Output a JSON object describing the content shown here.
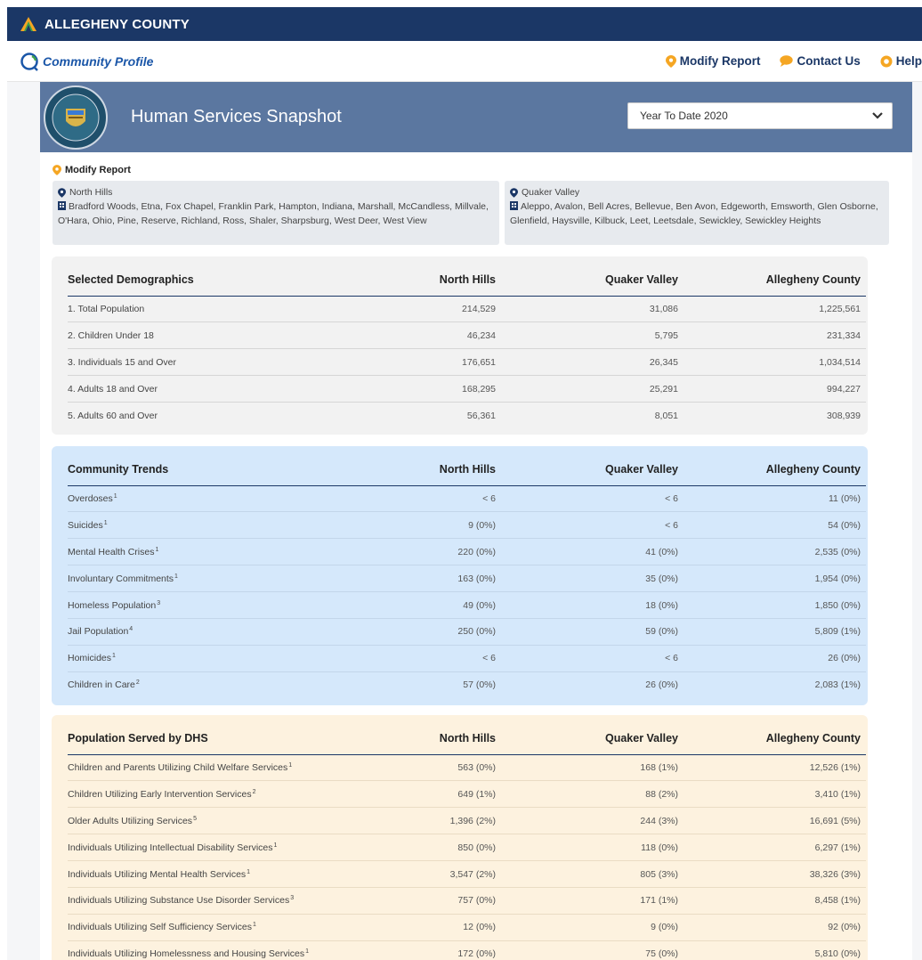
{
  "topbar": {
    "brand": "ALLEGHENY COUNTY"
  },
  "nav": {
    "brand": "Community Profile",
    "links": [
      "Modify Report",
      "Contact Us",
      "Help"
    ]
  },
  "header": {
    "title": "Human Services Snapshot",
    "period": "Year To Date 2020"
  },
  "modify_label": "Modify Report",
  "regions": [
    {
      "name": "North Hills",
      "municipalities": "Bradford Woods, Etna, Fox Chapel, Franklin Park, Hampton, Indiana, Marshall, McCandless, Millvale, O'Hara, Ohio, Pine, Reserve, Richland, Ross, Shaler, Sharpsburg, West Deer, West View"
    },
    {
      "name": "Quaker Valley",
      "municipalities": "Aleppo, Avalon, Bell Acres, Bellevue, Ben Avon, Edgeworth, Emsworth, Glen Osborne, Glenfield, Haysville, Kilbuck, Leet, Leetsdale, Sewickley, Sewickley Heights"
    }
  ],
  "colors": {
    "topbar": "#1b3766",
    "header": "#5b77a0",
    "accent_orange": "#f5a623",
    "blue_card": "#d5e8fb",
    "orange_card": "#fdf2df",
    "gray_card": "#f2f2f2"
  },
  "tables": {
    "demographics": {
      "headers": [
        "Selected Demographics",
        "North Hills",
        "Quaker Valley",
        "Allegheny County"
      ],
      "rows": [
        {
          "label": "1. Total Population",
          "sup": "",
          "values": [
            "214,529",
            "31,086",
            "1,225,561"
          ]
        },
        {
          "label": "2. Children Under 18",
          "sup": "",
          "values": [
            "46,234",
            "5,795",
            "231,334"
          ]
        },
        {
          "label": "3. Individuals 15 and Over",
          "sup": "",
          "values": [
            "176,651",
            "26,345",
            "1,034,514"
          ]
        },
        {
          "label": "4. Adults 18 and Over",
          "sup": "",
          "values": [
            "168,295",
            "25,291",
            "994,227"
          ]
        },
        {
          "label": "5. Adults 60 and Over",
          "sup": "",
          "values": [
            "56,361",
            "8,051",
            "308,939"
          ]
        }
      ]
    },
    "trends": {
      "headers": [
        "Community Trends",
        "North Hills",
        "Quaker Valley",
        "Allegheny County"
      ],
      "rows": [
        {
          "label": "Overdoses",
          "sup": "1",
          "values": [
            "< 6",
            "< 6",
            "11 (0%)"
          ]
        },
        {
          "label": "Suicides",
          "sup": "1",
          "values": [
            "9 (0%)",
            "< 6",
            "54 (0%)"
          ]
        },
        {
          "label": "Mental Health Crises",
          "sup": "1",
          "values": [
            "220 (0%)",
            "41 (0%)",
            "2,535 (0%)"
          ]
        },
        {
          "label": "Involuntary Commitments",
          "sup": "1",
          "values": [
            "163 (0%)",
            "35 (0%)",
            "1,954 (0%)"
          ]
        },
        {
          "label": "Homeless Population",
          "sup": "3",
          "values": [
            "49 (0%)",
            "18 (0%)",
            "1,850 (0%)"
          ]
        },
        {
          "label": "Jail Population",
          "sup": "4",
          "values": [
            "250 (0%)",
            "59 (0%)",
            "5,809 (1%)"
          ]
        },
        {
          "label": "Homicides",
          "sup": "1",
          "values": [
            "< 6",
            "< 6",
            "26 (0%)"
          ]
        },
        {
          "label": "Children in Care",
          "sup": "2",
          "values": [
            "57 (0%)",
            "26 (0%)",
            "2,083 (1%)"
          ]
        }
      ]
    },
    "dhs": {
      "headers": [
        "Population Served by DHS",
        "North Hills",
        "Quaker Valley",
        "Allegheny County"
      ],
      "rows": [
        {
          "label": "Children and Parents Utilizing Child Welfare Services",
          "sup": "1",
          "values": [
            "563 (0%)",
            "168 (1%)",
            "12,526 (1%)"
          ]
        },
        {
          "label": "Children Utilizing Early Intervention Services",
          "sup": "2",
          "values": [
            "649 (1%)",
            "88 (2%)",
            "3,410 (1%)"
          ]
        },
        {
          "label": "Older Adults Utilizing Services",
          "sup": "5",
          "values": [
            "1,396 (2%)",
            "244 (3%)",
            "16,691 (5%)"
          ]
        },
        {
          "label": "Individuals Utilizing Intellectual Disability Services",
          "sup": "1",
          "values": [
            "850 (0%)",
            "118 (0%)",
            "6,297 (1%)"
          ]
        },
        {
          "label": "Individuals Utilizing Mental Health Services",
          "sup": "1",
          "values": [
            "3,547 (2%)",
            "805 (3%)",
            "38,326 (3%)"
          ]
        },
        {
          "label": "Individuals Utilizing Substance Use Disorder Services",
          "sup": "3",
          "values": [
            "757 (0%)",
            "171 (1%)",
            "8,458 (1%)"
          ]
        },
        {
          "label": "Individuals Utilizing Self Sufficiency Services",
          "sup": "1",
          "values": [
            "12 (0%)",
            "9 (0%)",
            "92 (0%)"
          ]
        },
        {
          "label": "Individuals Utilizing Homelessness and Housing Services",
          "sup": "1",
          "values": [
            "172 (0%)",
            "75 (0%)",
            "5,810 (0%)"
          ]
        }
      ]
    }
  }
}
